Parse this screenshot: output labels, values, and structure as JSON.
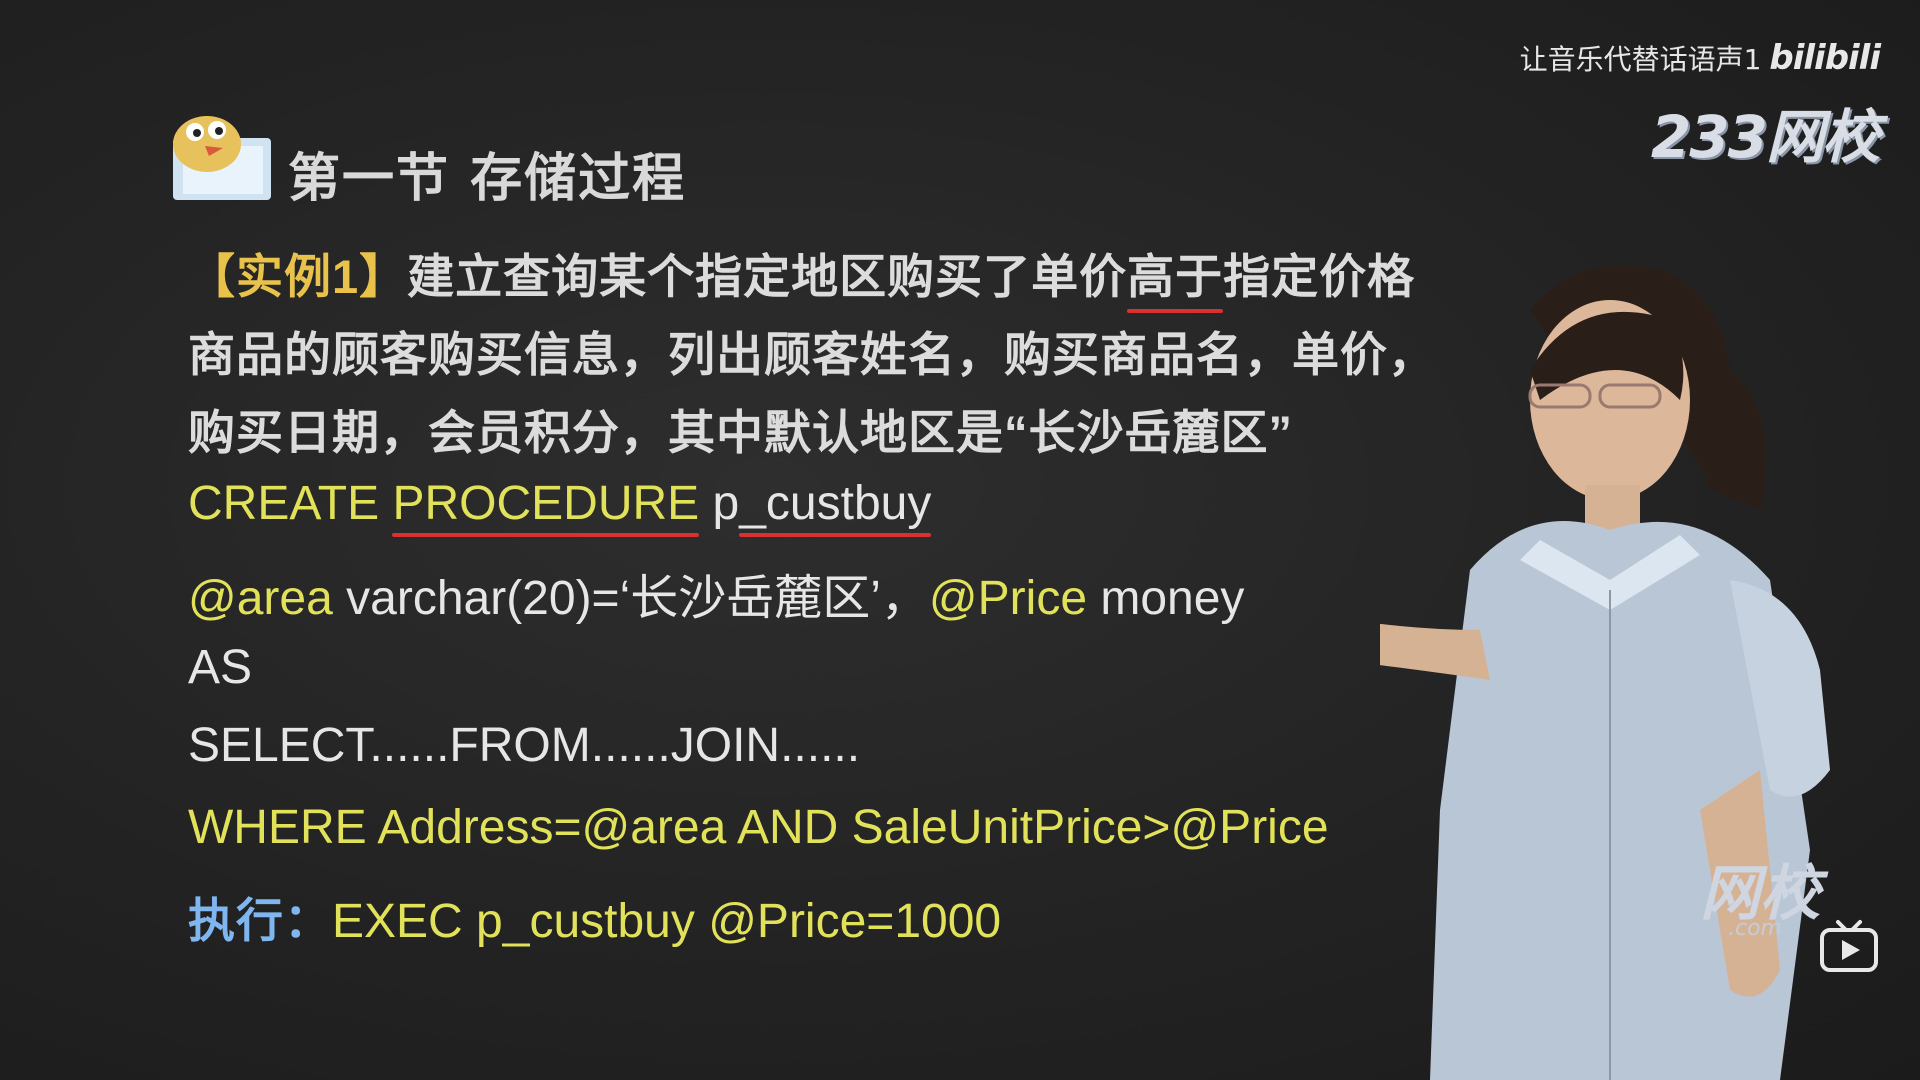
{
  "overlay": {
    "watermark_text": "让音乐代替话语声1",
    "platform_logo": "bilibili",
    "school_logo": "233网校",
    "right_logo": "网校",
    "right_logo_com": ".com"
  },
  "slide": {
    "section_title": "第一节  存储过程",
    "example_tag": "【实例1】",
    "line1_rest_a": "建立查询某个指定地区购买了单价",
    "line1_highlight": "高于",
    "line1_rest_b": "指定价格",
    "line2": "商品的顾客购买信息，列出顾客姓名，购买商品名，单价，",
    "line3": "购买日期，会员积分，其中默认地区是“长沙岳麓区”",
    "code1_kw1": "CREATE ",
    "code1_kw2": "PROCEDURE",
    "code1_space": " ",
    "code1_p": "p",
    "code1_name": "_custbuy",
    "code2_param1": "@area",
    "code2_rest": " varchar(20)=‘长沙岳麓区’，",
    "code2_param2": "@Price",
    "code2_type": " money",
    "code3": "AS",
    "code4": "SELECT......FROM......JOIN......",
    "code5": "WHERE Address=@area AND SaleUnitPrice>@Price",
    "exec_label": "执行：",
    "exec_kw": "EXEC  ",
    "exec_rest": "p_custbuy @Price=1000"
  },
  "icons": [
    "mascot-icon",
    "tv-play-icon"
  ],
  "colors": {
    "background": "#232323",
    "yellow": "#e2e25a",
    "white": "#e6e6e6",
    "blue": "#7fb6ef",
    "orange": "#e8c24a",
    "underline_red": "#d8312f"
  }
}
